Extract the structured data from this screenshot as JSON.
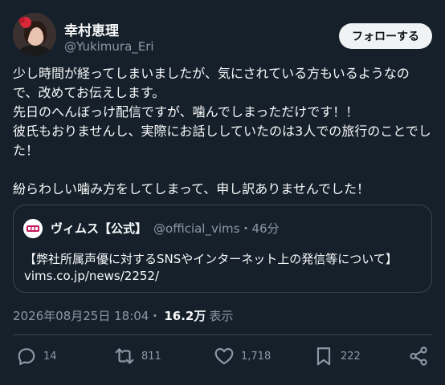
{
  "author": {
    "name": "幸村恵理",
    "handle": "@Yukimura_Eri",
    "follow_label": "フォローする"
  },
  "tweet": {
    "text": "少し時間が経ってしまいましたが、気にされている方もいるようなので、改めてお伝えします。\n先日のへんぼっけ配信ですが、噛んでしまっただけです！！\n彼氏もおりませんし、実際にお話ししていたのは3人での旅行のことでした！\n\n紛らわしい噛み方をしてしまって、申し訳ありませんでした！"
  },
  "quote": {
    "name": "ヴィムス【公式】",
    "handle": "@official_vims",
    "time": "・46分",
    "text_line1": "【弊社所属声優に対するSNSやインターネット上の発信等について】",
    "text_line2": "vims.co.jp/news/2252/"
  },
  "meta": {
    "datetime": "2026年08月25日 18:04・",
    "views": "16.2万",
    "views_label": "表示"
  },
  "actions": {
    "reply_count": "14",
    "repost_count": "811",
    "like_count": "1,718",
    "bookmark_count": "222"
  },
  "icons": [
    "reply-icon",
    "repost-icon",
    "like-icon",
    "bookmark-icon",
    "share-icon"
  ],
  "colors": {
    "background": "#15202b",
    "text": "#f7f9f9",
    "secondary": "#8b98a5",
    "border": "#38444d"
  }
}
